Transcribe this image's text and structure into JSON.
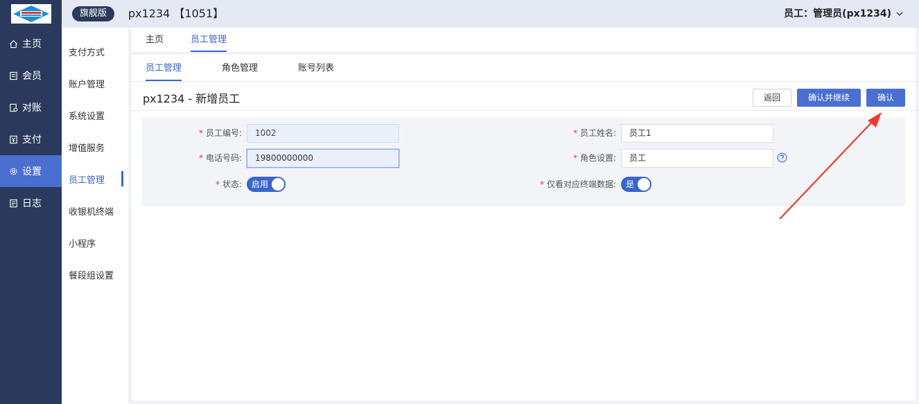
{
  "header": {
    "edition": "旗舰版",
    "store": "px1234 【1051】",
    "user": "员工：管理员(px1234)"
  },
  "sidebar": {
    "items": [
      {
        "label": "主页",
        "icon": "home-icon"
      },
      {
        "label": "会员",
        "icon": "member-icon"
      },
      {
        "label": "对账",
        "icon": "reconcile-icon"
      },
      {
        "label": "支付",
        "icon": "payment-icon"
      },
      {
        "label": "设置",
        "icon": "gear-icon"
      },
      {
        "label": "日志",
        "icon": "log-icon"
      }
    ]
  },
  "submenu": {
    "items": [
      "支付方式",
      "账户管理",
      "系统设置",
      "增值服务",
      "员工管理",
      "收银机终端",
      "小程序",
      "餐段组设置"
    ]
  },
  "tabs": {
    "top": [
      "主页",
      "员工管理"
    ],
    "sub": [
      "员工管理",
      "角色管理",
      "账号列表"
    ]
  },
  "page": {
    "title": "px1234 - 新增员工",
    "buttons": {
      "back": "返回",
      "confirm_continue": "确认并继续",
      "confirm": "确认"
    }
  },
  "form": {
    "required_mark": "*",
    "employee_no_label": "员工编号:",
    "employee_no_value": "1002",
    "employee_name_label": "员工姓名:",
    "employee_name_value": "员工1",
    "phone_label": "电话号码:",
    "phone_value": "19800000000",
    "role_label": "角色设置:",
    "role_value": "员工",
    "status_label": "状态:",
    "status_value": "启用",
    "terminal_only_label": "仅看对应终端数据:",
    "terminal_only_value": "是"
  },
  "colors": {
    "sidebar": "#2b3a5c",
    "accent": "#4a6fd1",
    "annotation_arrow": "#f03a2e"
  }
}
